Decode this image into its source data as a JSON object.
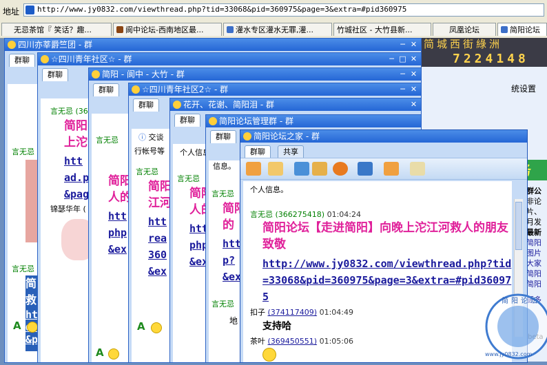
{
  "address": {
    "label": "地址",
    "url": "http://www.jy0832.com/viewthread.php?tid=33068&pid=360975&page=3&extra=#pid360975"
  },
  "tabs": [
    {
      "label": "无忌茶馆『 笑话？趣..."
    },
    {
      "label": "阆中论坛-西南地区最..."
    },
    {
      "label": "灌水专区灌水无罪,灌..."
    },
    {
      "label": "竹城社区 - 大竹县新..."
    },
    {
      "label": "凤凰论坛"
    },
    {
      "label": "简阳论坛"
    }
  ],
  "ad": {
    "banner_title": "简城西街綠洲",
    "phone": "7224148",
    "service": "服务",
    "settings": "统设置",
    "side_texts": [
      "群公",
      "非论",
      "片、",
      "月发",
      "最新",
      "简阳",
      "图片",
      "大家",
      "简阳",
      "简阳",
      "更多"
    ],
    "beta": "beta"
  },
  "windows": [
    {
      "title": "四川亦莘爵竺团 - 群",
      "tab": "群聊"
    },
    {
      "title": "☆四川青年社区☆ - 群",
      "tab": "群聊"
    },
    {
      "title": "简阳 - 阆中 - 大竹 - 群",
      "tab": "群聊"
    },
    {
      "title": "☆四川青年社区2☆ - 群",
      "tab": "群聊"
    },
    {
      "title": "花开、花谢、简阳泪 - 群",
      "tab": "群聊"
    },
    {
      "title": "简阳论坛管理群 - 群",
      "tab": "群聊"
    },
    {
      "title": "简阳论坛之家 - 群",
      "tab": "群聊",
      "tab2": "共享"
    }
  ],
  "bg_fragments": {
    "sender": "言无忌",
    "sender_num": "(36",
    "jian": "简阳",
    "shang": "上沱",
    "htt": "htt",
    "ad": "ad.p",
    "pag": "&pag",
    "jinse": "锦瑟华年 (",
    "jiao": "交谈",
    "geren": "个人信息",
    "xinxi": "信息。",
    "renr": "人的",
    "jiang": "江河",
    "php": "php",
    "ex": "&ex",
    "read": "rea",
    "num": "360",
    "hang": "行帐号等",
    "jiu": "救",
    "dd": "d.",
    "pp": "&p",
    "dedi": "的",
    "pq": "p?",
    "addr_short": "地"
  },
  "chat": {
    "intro": "个人信息。",
    "messages": [
      {
        "sender": "言无忌",
        "id": "(366275418)",
        "time": "01:04:24",
        "text": "简阳论坛【走进简阳】向晚上沱江河救人的朋友致敬",
        "link": "http://www.jy0832.com/viewthread.php?tid=33068&pid=360975&page=3&extra=#pid360975"
      },
      {
        "sender": "扣子",
        "id": "(374117409)",
        "time": "01:04:49",
        "text": "支持哈"
      },
      {
        "sender": "茶叶",
        "id": "(369450551)",
        "time": "01:05:06",
        "text": ""
      }
    ]
  },
  "watermark": "www.jy0832.com",
  "watermark_top": "简阳论坛",
  "colors": {
    "accent": "#2566d6",
    "pink": "#e0209a",
    "link": "#1a1a9c",
    "sender": "#008000"
  }
}
